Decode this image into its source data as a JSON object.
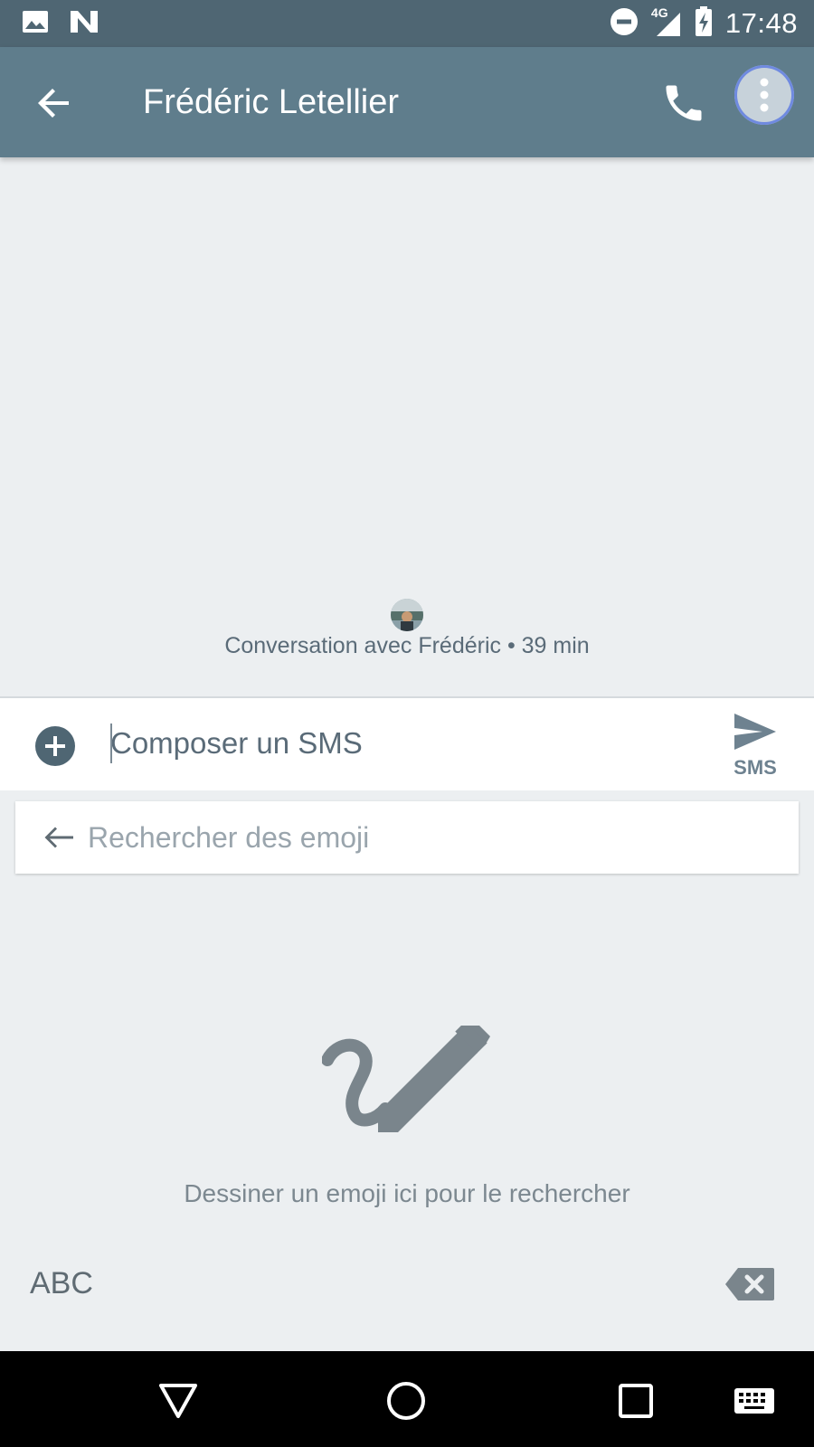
{
  "status_bar": {
    "time": "17:48",
    "network": "4G",
    "icons": [
      "image-notification-icon",
      "n-notification-icon",
      "do-not-disturb-icon",
      "signal-icon",
      "battery-charging-icon"
    ]
  },
  "app_bar": {
    "title": "Frédéric Letellier",
    "back_icon": "arrow-back-icon",
    "call_icon": "phone-icon",
    "more_icon": "more-vert-icon"
  },
  "conversation": {
    "info": "Conversation avec Frédéric • 39 min"
  },
  "compose": {
    "placeholder": "Composer un SMS",
    "send_label": "SMS"
  },
  "emoji_search": {
    "placeholder": "Rechercher des emoji"
  },
  "emoji_draw": {
    "hint": "Dessiner un emoji ici pour le rechercher"
  },
  "keyboard": {
    "abc_label": "ABC"
  },
  "colors": {
    "status_bar": "#4f6673",
    "app_bar": "#5f7d8c",
    "background": "#eceff1",
    "accent_icon": "#4f6673"
  }
}
